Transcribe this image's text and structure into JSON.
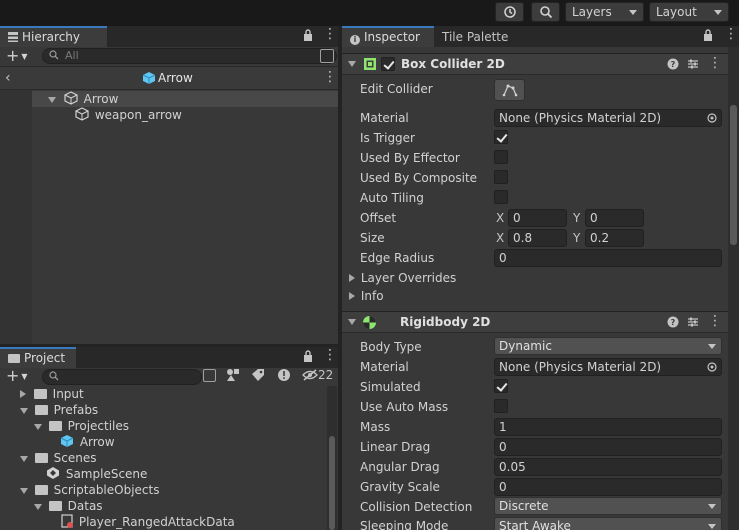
{
  "toolbar": {
    "layers_label": "Layers",
    "layout_label": "Layout"
  },
  "hierarchy": {
    "tab_label": "Hierarchy",
    "search_placeholder": "All",
    "scene_title": "Arrow",
    "items": [
      {
        "label": "Arrow"
      },
      {
        "label": "weapon_arrow"
      }
    ]
  },
  "project": {
    "tab_label": "Project",
    "hidden_count": "22",
    "tree": [
      {
        "label": "Input"
      },
      {
        "label": "Prefabs"
      },
      {
        "label": "Projectiles"
      },
      {
        "label": "Arrow"
      },
      {
        "label": "Scenes"
      },
      {
        "label": "SampleScene"
      },
      {
        "label": "ScriptableObjects"
      },
      {
        "label": "Datas"
      },
      {
        "label": "Player_RangedAttackData"
      }
    ]
  },
  "inspector": {
    "tab_inspector": "Inspector",
    "tab_tile_palette": "Tile Palette",
    "box_collider": {
      "title": "Box Collider 2D",
      "enabled": true,
      "props": {
        "edit_collider": "Edit Collider",
        "material": "Material",
        "material_value": "None (Physics Material 2D)",
        "is_trigger": "Is Trigger",
        "used_by_effector": "Used By Effector",
        "used_by_composite": "Used By Composite",
        "auto_tiling": "Auto Tiling",
        "offset": "Offset",
        "offset_x": "0",
        "offset_y": "0",
        "size": "Size",
        "size_x": "0.8",
        "size_y": "0.2",
        "edge_radius": "Edge Radius",
        "edge_radius_value": "0",
        "layer_overrides": "Layer Overrides",
        "info": "Info",
        "x_label": "X",
        "y_label": "Y"
      }
    },
    "rigidbody": {
      "title": "Rigidbody 2D",
      "props": {
        "body_type": "Body Type",
        "body_type_value": "Dynamic",
        "material": "Material",
        "material_value": "None (Physics Material 2D)",
        "simulated": "Simulated",
        "use_auto_mass": "Use Auto Mass",
        "mass": "Mass",
        "mass_value": "1",
        "linear_drag": "Linear Drag",
        "linear_drag_value": "0",
        "angular_drag": "Angular Drag",
        "angular_drag_value": "0.05",
        "gravity_scale": "Gravity Scale",
        "gravity_scale_value": "0",
        "collision_detection": "Collision Detection",
        "collision_detection_value": "Discrete",
        "sleeping_mode": "Sleeping Mode",
        "sleeping_mode_value": "Start Awake"
      }
    }
  },
  "colors": {
    "accent": "#3a79bb",
    "panel": "#383838",
    "collider_green": "#8ee66e"
  }
}
